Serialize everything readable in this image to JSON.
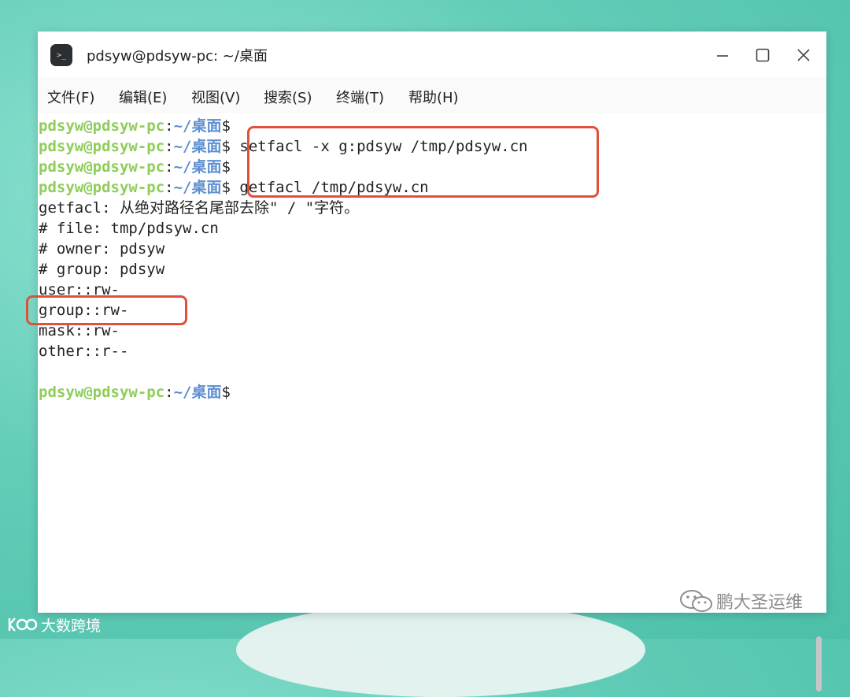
{
  "window": {
    "title": "pdsyw@pdsyw-pc: ~/桌面",
    "icon": "terminal-icon",
    "controls": [
      "minimize-icon",
      "maximize-icon",
      "close-icon"
    ]
  },
  "menu": {
    "items": [
      "文件(F)",
      "编辑(E)",
      "视图(V)",
      "搜索(S)",
      "终端(T)",
      "帮助(H)"
    ]
  },
  "terminal": {
    "prompt_user": "pdsyw@pdsyw-pc",
    "prompt_sep": ":",
    "prompt_path": "~/桌面",
    "prompt_dollar": "$",
    "commands": [
      "",
      "setfacl -x g:pdsyw /tmp/pdsyw.cn",
      "",
      "getfacl /tmp/pdsyw.cn"
    ],
    "output": [
      "getfacl: 从绝对路径名尾部去除\" / \"字符。",
      "# file: tmp/pdsyw.cn",
      "# owner: pdsyw",
      "# group: pdsyw",
      "user::rw-",
      "group::rw-",
      "mask::rw-",
      "other::r--"
    ],
    "final_prompt_command": ""
  },
  "colors": {
    "prompt_user": "#8fcd5b",
    "prompt_path": "#5d8fd1",
    "highlight": "#e0503a"
  },
  "watermarks": {
    "right": "鹏大圣运维",
    "left": "大数跨境"
  }
}
